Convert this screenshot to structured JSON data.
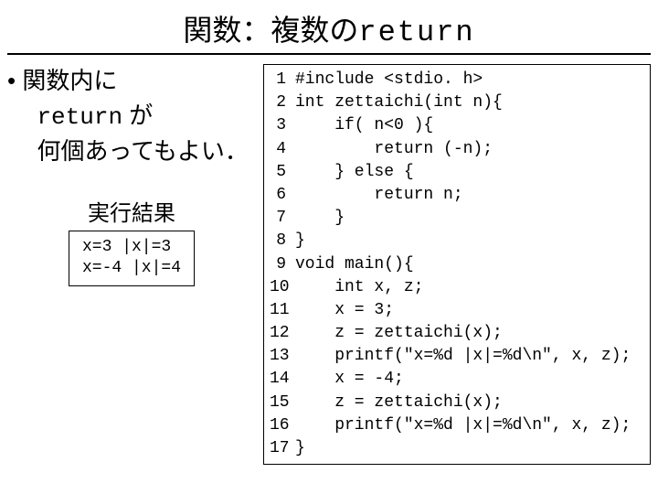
{
  "title_left": "関数：複数の",
  "title_right": "return",
  "bullet_prefix": "• ",
  "bullet_line1": "関数内に",
  "bullet_line2_mono": "return",
  "bullet_line2_tail": " が",
  "bullet_line3": "何個あってもよい．",
  "result_title": "実行結果",
  "result_line1": "x=3 |x|=3",
  "result_line2": "x=-4 |x|=4",
  "code": [
    "#include <stdio. h>",
    "int zettaichi(int n){",
    "    if( n<0 ){",
    "        return (-n);",
    "    } else {",
    "        return n;",
    "    }",
    "}",
    "void main(){",
    "    int x, z;",
    "    x = 3;",
    "    z = zettaichi(x);",
    "    printf(\"x=%d |x|=%d\\n\", x, z);",
    "    x = -4;",
    "    z = zettaichi(x);",
    "    printf(\"x=%d |x|=%d\\n\", x, z);",
    "}"
  ]
}
